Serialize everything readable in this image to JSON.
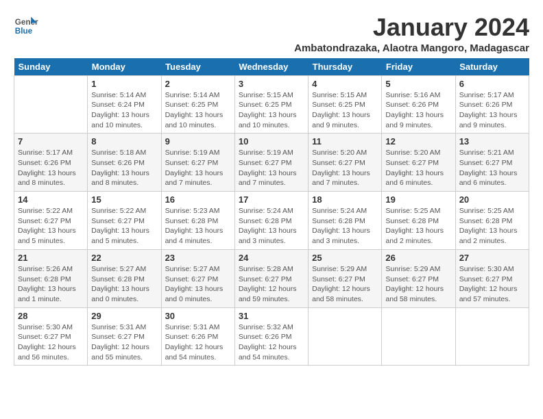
{
  "logo": {
    "general": "General",
    "blue": "Blue"
  },
  "title": "January 2024",
  "location": "Ambatondrazaka, Alaotra Mangoro, Madagascar",
  "weekdays": [
    "Sunday",
    "Monday",
    "Tuesday",
    "Wednesday",
    "Thursday",
    "Friday",
    "Saturday"
  ],
  "weeks": [
    [
      {
        "day": "",
        "info": ""
      },
      {
        "day": "1",
        "info": "Sunrise: 5:14 AM\nSunset: 6:24 PM\nDaylight: 13 hours\nand 10 minutes."
      },
      {
        "day": "2",
        "info": "Sunrise: 5:14 AM\nSunset: 6:25 PM\nDaylight: 13 hours\nand 10 minutes."
      },
      {
        "day": "3",
        "info": "Sunrise: 5:15 AM\nSunset: 6:25 PM\nDaylight: 13 hours\nand 10 minutes."
      },
      {
        "day": "4",
        "info": "Sunrise: 5:15 AM\nSunset: 6:25 PM\nDaylight: 13 hours\nand 9 minutes."
      },
      {
        "day": "5",
        "info": "Sunrise: 5:16 AM\nSunset: 6:26 PM\nDaylight: 13 hours\nand 9 minutes."
      },
      {
        "day": "6",
        "info": "Sunrise: 5:17 AM\nSunset: 6:26 PM\nDaylight: 13 hours\nand 9 minutes."
      }
    ],
    [
      {
        "day": "7",
        "info": "Sunrise: 5:17 AM\nSunset: 6:26 PM\nDaylight: 13 hours\nand 8 minutes."
      },
      {
        "day": "8",
        "info": "Sunrise: 5:18 AM\nSunset: 6:26 PM\nDaylight: 13 hours\nand 8 minutes."
      },
      {
        "day": "9",
        "info": "Sunrise: 5:19 AM\nSunset: 6:27 PM\nDaylight: 13 hours\nand 7 minutes."
      },
      {
        "day": "10",
        "info": "Sunrise: 5:19 AM\nSunset: 6:27 PM\nDaylight: 13 hours\nand 7 minutes."
      },
      {
        "day": "11",
        "info": "Sunrise: 5:20 AM\nSunset: 6:27 PM\nDaylight: 13 hours\nand 7 minutes."
      },
      {
        "day": "12",
        "info": "Sunrise: 5:20 AM\nSunset: 6:27 PM\nDaylight: 13 hours\nand 6 minutes."
      },
      {
        "day": "13",
        "info": "Sunrise: 5:21 AM\nSunset: 6:27 PM\nDaylight: 13 hours\nand 6 minutes."
      }
    ],
    [
      {
        "day": "14",
        "info": "Sunrise: 5:22 AM\nSunset: 6:27 PM\nDaylight: 13 hours\nand 5 minutes."
      },
      {
        "day": "15",
        "info": "Sunrise: 5:22 AM\nSunset: 6:27 PM\nDaylight: 13 hours\nand 5 minutes."
      },
      {
        "day": "16",
        "info": "Sunrise: 5:23 AM\nSunset: 6:28 PM\nDaylight: 13 hours\nand 4 minutes."
      },
      {
        "day": "17",
        "info": "Sunrise: 5:24 AM\nSunset: 6:28 PM\nDaylight: 13 hours\nand 3 minutes."
      },
      {
        "day": "18",
        "info": "Sunrise: 5:24 AM\nSunset: 6:28 PM\nDaylight: 13 hours\nand 3 minutes."
      },
      {
        "day": "19",
        "info": "Sunrise: 5:25 AM\nSunset: 6:28 PM\nDaylight: 13 hours\nand 2 minutes."
      },
      {
        "day": "20",
        "info": "Sunrise: 5:25 AM\nSunset: 6:28 PM\nDaylight: 13 hours\nand 2 minutes."
      }
    ],
    [
      {
        "day": "21",
        "info": "Sunrise: 5:26 AM\nSunset: 6:28 PM\nDaylight: 13 hours\nand 1 minute."
      },
      {
        "day": "22",
        "info": "Sunrise: 5:27 AM\nSunset: 6:28 PM\nDaylight: 13 hours\nand 0 minutes."
      },
      {
        "day": "23",
        "info": "Sunrise: 5:27 AM\nSunset: 6:27 PM\nDaylight: 13 hours\nand 0 minutes."
      },
      {
        "day": "24",
        "info": "Sunrise: 5:28 AM\nSunset: 6:27 PM\nDaylight: 12 hours\nand 59 minutes."
      },
      {
        "day": "25",
        "info": "Sunrise: 5:29 AM\nSunset: 6:27 PM\nDaylight: 12 hours\nand 58 minutes."
      },
      {
        "day": "26",
        "info": "Sunrise: 5:29 AM\nSunset: 6:27 PM\nDaylight: 12 hours\nand 58 minutes."
      },
      {
        "day": "27",
        "info": "Sunrise: 5:30 AM\nSunset: 6:27 PM\nDaylight: 12 hours\nand 57 minutes."
      }
    ],
    [
      {
        "day": "28",
        "info": "Sunrise: 5:30 AM\nSunset: 6:27 PM\nDaylight: 12 hours\nand 56 minutes."
      },
      {
        "day": "29",
        "info": "Sunrise: 5:31 AM\nSunset: 6:27 PM\nDaylight: 12 hours\nand 55 minutes."
      },
      {
        "day": "30",
        "info": "Sunrise: 5:31 AM\nSunset: 6:26 PM\nDaylight: 12 hours\nand 54 minutes."
      },
      {
        "day": "31",
        "info": "Sunrise: 5:32 AM\nSunset: 6:26 PM\nDaylight: 12 hours\nand 54 minutes."
      },
      {
        "day": "",
        "info": ""
      },
      {
        "day": "",
        "info": ""
      },
      {
        "day": "",
        "info": ""
      }
    ]
  ]
}
